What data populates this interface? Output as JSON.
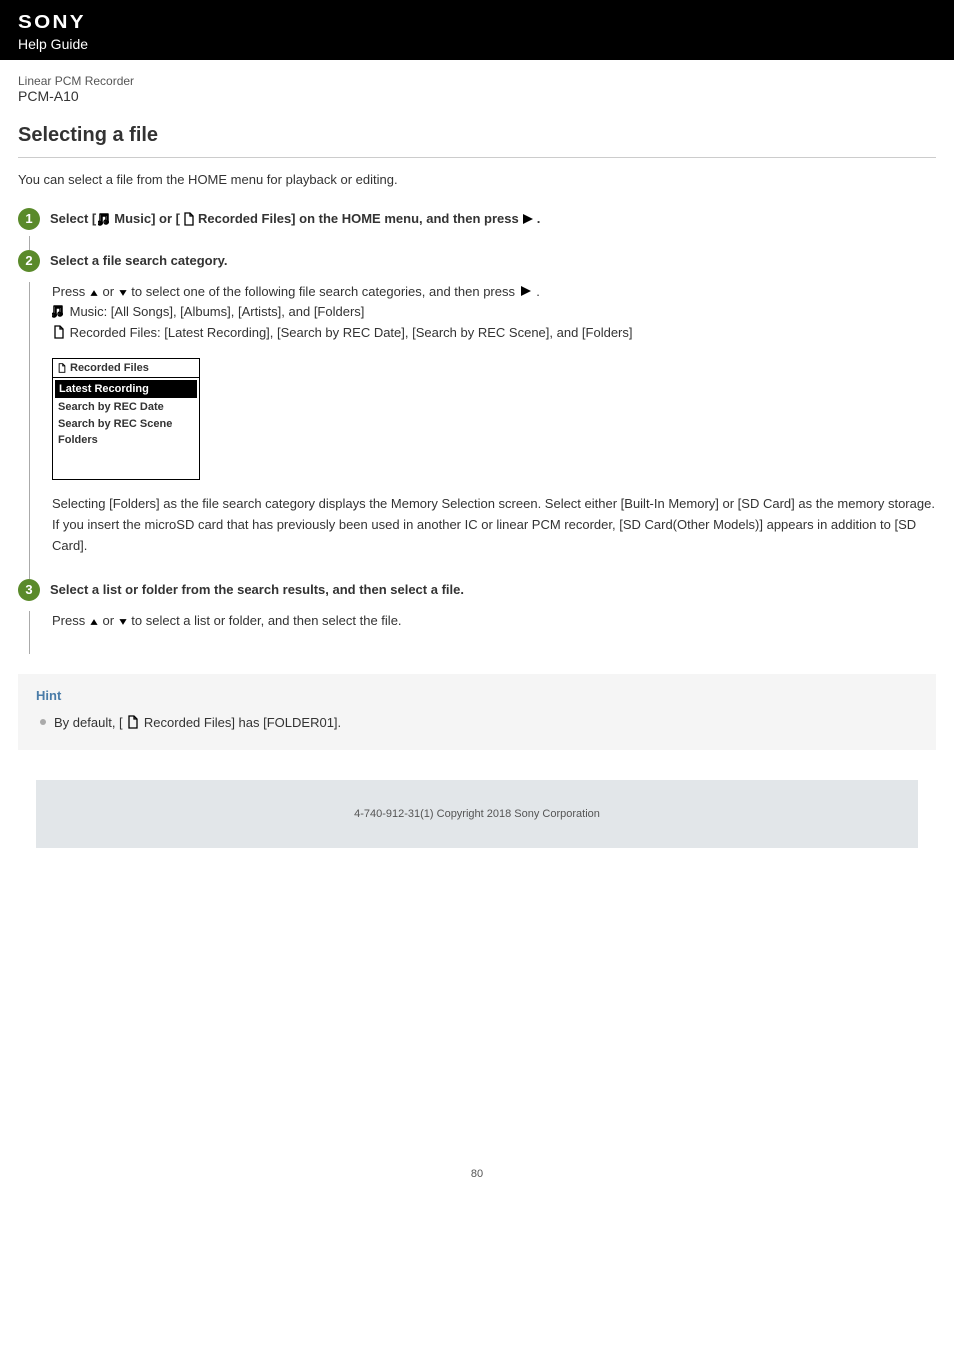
{
  "header": {
    "brand": "SONY",
    "subtitle": "Help Guide"
  },
  "product": {
    "category": "Linear PCM Recorder",
    "model": "PCM-A10"
  },
  "page": {
    "title": "Selecting a file",
    "intro": "You can select a file from the HOME menu for playback or editing.",
    "number": "80"
  },
  "steps": [
    {
      "num": "1",
      "title_parts": {
        "a": "Select [",
        "b": " Music] or [",
        "c": " Recorded Files] on the HOME menu, and then press",
        "d": "."
      }
    },
    {
      "num": "2",
      "title": "Select a file search category.",
      "body_parts": {
        "a": "Press ",
        "b": " or ",
        "c": " to select one of the following file search categories, and then press ",
        "d": ".",
        "music_line": " Music: [All Songs], [Albums], [Artists], and [Folders]",
        "rec_line": "Recorded Files: [Latest Recording], [Search by REC Date], [Search by REC Scene], and [Folders]"
      },
      "screenshot": {
        "header": "Recorded Files",
        "items": [
          "Latest Recording",
          "Search by REC Date",
          "Search by REC Scene",
          "Folders"
        ]
      },
      "after": {
        "p1": "Selecting [Folders] as the file search category displays the Memory Selection screen. Select either [Built-In Memory] or [SD Card] as the memory storage.",
        "p2": "If you insert the microSD card that has previously been used in another IC or linear PCM recorder, [SD Card(Other Models)] appears in addition to [SD Card]."
      }
    },
    {
      "num": "3",
      "title": "Select a list or folder from the search results, and then select a file.",
      "body_parts": {
        "a": "Press ",
        "b": " or ",
        "c": " to select a list or folder, and then select the file."
      }
    }
  ],
  "hint": {
    "title": "Hint",
    "item_parts": {
      "a": "By default, [",
      "b": " Recorded Files] has [FOLDER01]."
    }
  },
  "footer": {
    "copyright": "4-740-912-31(1) Copyright 2018 Sony Corporation"
  }
}
